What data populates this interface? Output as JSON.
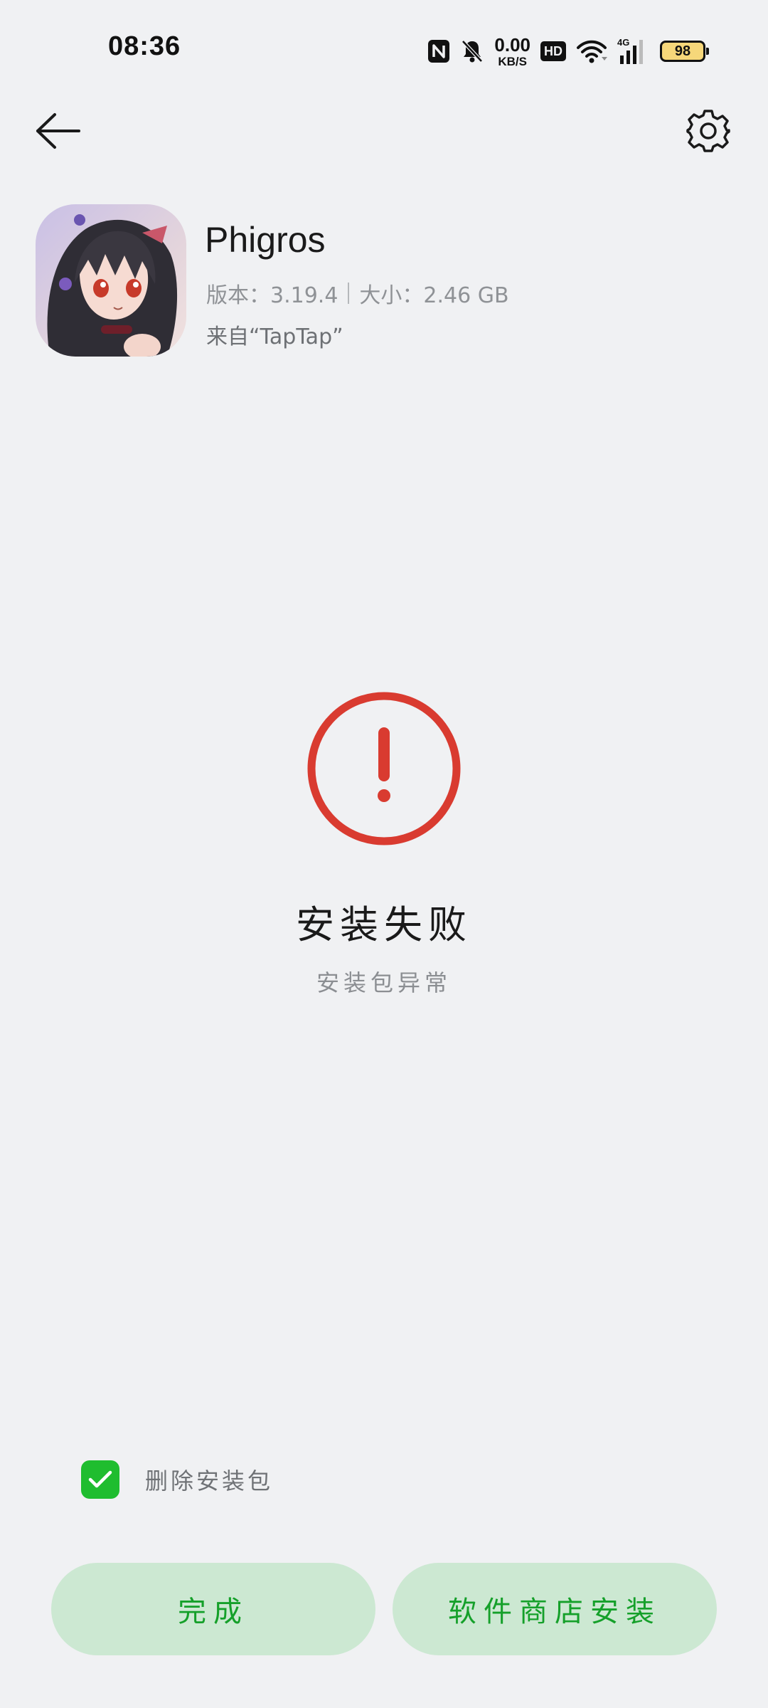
{
  "status_bar": {
    "time": "08:36",
    "net_speed_value": "0.00",
    "net_speed_unit": "KB/S",
    "hd_label": "HD",
    "network_type": "4G",
    "battery_level": "98",
    "icons": [
      "nfc-icon",
      "mute-icon",
      "wifi-icon",
      "signal-icon",
      "battery-icon"
    ]
  },
  "toolbar": {
    "back_icon": "back-arrow-icon",
    "settings_icon": "gear-icon"
  },
  "app": {
    "name": "Phigros",
    "version_text": "版本：3.19.4",
    "size_text": "大小：2.46 GB",
    "source_text": "来自“TapTap”"
  },
  "result": {
    "icon": "error-exclamation-icon",
    "title": "安装失败",
    "subtitle": "安装包异常"
  },
  "options": {
    "delete_package_label": "删除安装包",
    "delete_package_checked": true
  },
  "actions": {
    "done_label": "完成",
    "store_install_label": "软件商店安装"
  },
  "colors": {
    "background": "#f0f1f3",
    "error_red": "#d93b30",
    "accent_green": "#1fbd2f",
    "button_bg": "#cce8d2",
    "button_text": "#15a02a"
  }
}
